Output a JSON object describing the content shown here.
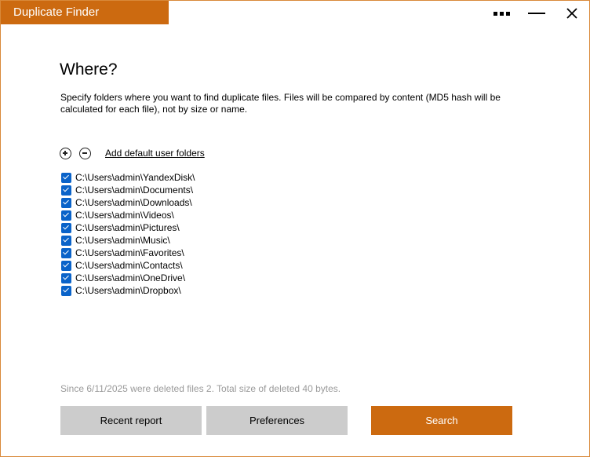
{
  "window": {
    "title": "Duplicate Finder",
    "accent_color": "#cc6a10",
    "controls": [
      "more-icon",
      "minimize-icon",
      "close-icon"
    ],
    "close_glyph": "X"
  },
  "main": {
    "heading": "Where?",
    "description": "Specify folders where you want to find duplicate files. Files will be compared by content (MD5 hash will be calculated for each file), not by size or name.",
    "toolbar": {
      "add_icon": "plus-circle-icon",
      "remove_icon": "minus-circle-icon",
      "add_default_label": "Add default user folders"
    },
    "folders": [
      {
        "path": "C:\\Users\\admin\\YandexDisk\\",
        "checked": true
      },
      {
        "path": "C:\\Users\\admin\\Documents\\",
        "checked": true
      },
      {
        "path": "C:\\Users\\admin\\Downloads\\",
        "checked": true
      },
      {
        "path": "C:\\Users\\admin\\Videos\\",
        "checked": true
      },
      {
        "path": "C:\\Users\\admin\\Pictures\\",
        "checked": true
      },
      {
        "path": "C:\\Users\\admin\\Music\\",
        "checked": true
      },
      {
        "path": "C:\\Users\\admin\\Favorites\\",
        "checked": true
      },
      {
        "path": "C:\\Users\\admin\\Contacts\\",
        "checked": true
      },
      {
        "path": "C:\\Users\\admin\\OneDrive\\",
        "checked": true
      },
      {
        "path": "C:\\Users\\admin\\Dropbox\\",
        "checked": true
      }
    ],
    "checkbox_color": "#0a63c9"
  },
  "footer": {
    "status": "Since 6/11/2025 were deleted files 2. Total size of deleted 40 bytes.",
    "recent_report_label": "Recent report",
    "preferences_label": "Preferences",
    "search_label": "Search"
  }
}
